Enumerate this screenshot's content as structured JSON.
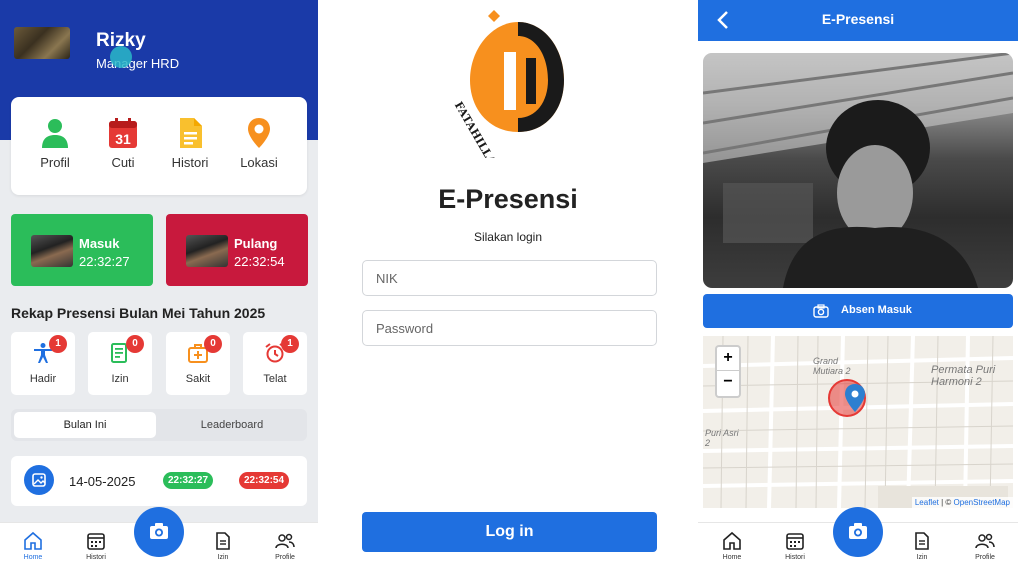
{
  "home": {
    "user": {
      "name": "Rizky",
      "role": "Manager HRD"
    },
    "menu": [
      {
        "label": "Profil",
        "icon": "person-icon",
        "color": "#2bbd5a"
      },
      {
        "label": "Cuti",
        "icon": "calendar-icon",
        "color": "#e53935",
        "day": "31"
      },
      {
        "label": "Histori",
        "icon": "document-icon",
        "color": "#f9c02e"
      },
      {
        "label": "Lokasi",
        "icon": "map-pin-icon",
        "color": "#f7901e"
      }
    ],
    "masuk": {
      "label": "Masuk",
      "time": "22:32:27"
    },
    "pulang": {
      "label": "Pulang",
      "time": "22:32:54"
    },
    "rekap_title": "Rekap Presensi Bulan Mei Tahun 2025",
    "stats": [
      {
        "label": "Hadir",
        "count": "1",
        "icon": "accessibility-icon"
      },
      {
        "label": "Izin",
        "count": "0",
        "icon": "note-icon"
      },
      {
        "label": "Sakit",
        "count": "0",
        "icon": "medical-kit-icon"
      },
      {
        "label": "Telat",
        "count": "1",
        "icon": "alarm-icon"
      }
    ],
    "tabs": [
      "Bulan Ini",
      "Leaderboard"
    ],
    "history": [
      {
        "date": "14-05-2025",
        "in": "22:32:27",
        "out": "22:32:54"
      }
    ]
  },
  "nav": {
    "home": "Home",
    "histori": "Histori",
    "izin": "Izin",
    "profile": "Profile"
  },
  "login": {
    "logo_text": "FATAHILLAH",
    "title": "E-Presensi",
    "subtitle": "Silakan login",
    "nik_placeholder": "NIK",
    "password_placeholder": "Password",
    "button": "Log in"
  },
  "camera": {
    "title": "E-Presensi",
    "button": "Absen Masuk",
    "zoom_in": "+",
    "zoom_out": "−",
    "map_labels": {
      "grand_mutiara": "Grand Mutiara 2",
      "permata": "Permata Puri Harmoni 2",
      "puri_asri": "Puri Asri 2"
    },
    "attribution": {
      "leaflet": "Leaflet",
      "sep": " | © ",
      "osm": "OpenStreetMap"
    }
  },
  "colors": {
    "primary": "#1f6fe0",
    "header_blue": "#1a3aa8",
    "green": "#2bbd5a",
    "red": "#c8193d",
    "badge_red": "#e53935",
    "logo_orange": "#f7901e"
  }
}
